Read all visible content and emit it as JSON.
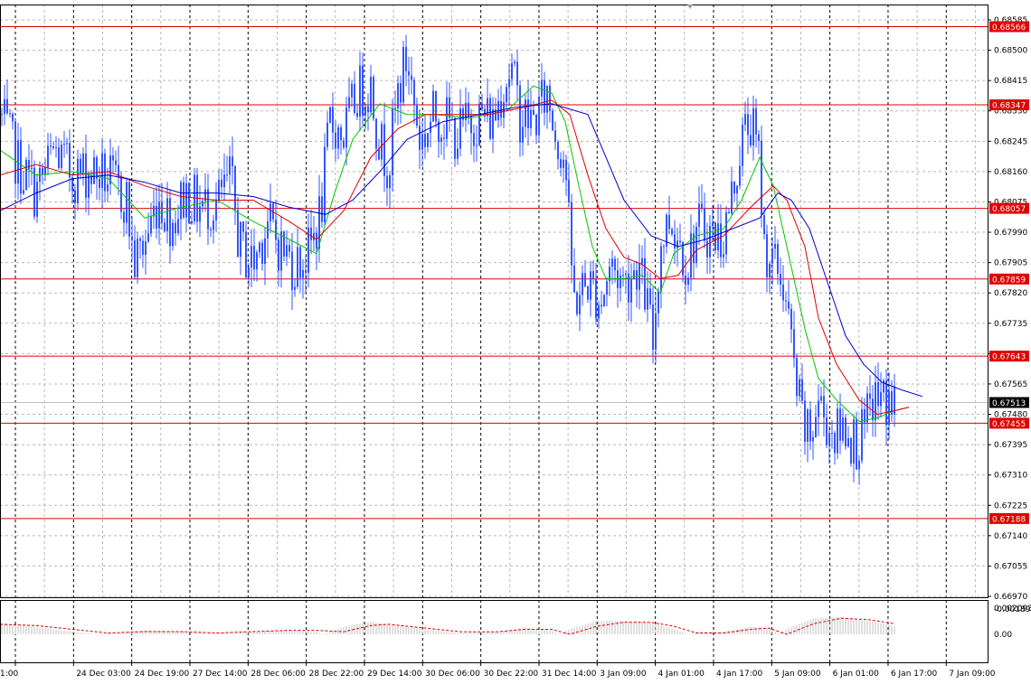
{
  "chart_data": [
    {
      "type": "candlestick",
      "title": "",
      "ylim": [
        0.6697,
        0.68585
      ],
      "y_ticks": [
        "0.68585",
        "0.68500",
        "0.68415",
        "0.68330",
        "0.68245",
        "0.68160",
        "0.68075",
        "0.67990",
        "0.67905",
        "0.67820",
        "0.67735",
        "0.67650",
        "0.67565",
        "0.67480",
        "0.67395",
        "0.67310",
        "0.67225",
        "0.67140",
        "0.67055",
        "0.66970"
      ],
      "x_ticks": [
        "1:00",
        "24 Dec 03:00",
        "24 Dec 19:00",
        "27 Dec 14:00",
        "28 Dec 06:00",
        "28 Dec 22:00",
        "29 Dec 14:00",
        "30 Dec 06:00",
        "30 Dec 22:00",
        "31 Dec 14:00",
        "3 Jan 09:00",
        "4 Jan 01:00",
        "4 Jan 17:00",
        "5 Jan 09:00",
        "6 Jan 01:00",
        "6 Jan 17:00",
        "7 Jan 09:00"
      ],
      "current_price": "0.67513",
      "horizontal_levels": [
        "0.68566",
        "0.68347",
        "0.68057",
        "0.67859",
        "0.67643",
        "0.67455",
        "0.67188"
      ],
      "price_path": [
        [
          0,
          0.6832
        ],
        [
          20,
          0.6818
        ],
        [
          40,
          0.681
        ],
        [
          60,
          0.6822
        ],
        [
          80,
          0.6815
        ],
        [
          100,
          0.6816
        ],
        [
          120,
          0.6814
        ],
        [
          140,
          0.6808
        ],
        [
          148,
          0.679
        ],
        [
          160,
          0.6796
        ],
        [
          175,
          0.6809
        ],
        [
          190,
          0.6802
        ],
        [
          205,
          0.681
        ],
        [
          220,
          0.6806
        ],
        [
          240,
          0.6807
        ],
        [
          255,
          0.6814
        ],
        [
          265,
          0.6795
        ],
        [
          280,
          0.679
        ],
        [
          295,
          0.6802
        ],
        [
          310,
          0.6795
        ],
        [
          325,
          0.679
        ],
        [
          340,
          0.6792
        ],
        [
          355,
          0.6805
        ],
        [
          365,
          0.683
        ],
        [
          380,
          0.6826
        ],
        [
          395,
          0.6838
        ],
        [
          410,
          0.684
        ],
        [
          420,
          0.6824
        ],
        [
          430,
          0.6818
        ],
        [
          440,
          0.6838
        ],
        [
          450,
          0.6848
        ],
        [
          465,
          0.6824
        ],
        [
          480,
          0.6832
        ],
        [
          495,
          0.683
        ],
        [
          505,
          0.6826
        ],
        [
          520,
          0.683
        ],
        [
          535,
          0.6832
        ],
        [
          545,
          0.683
        ],
        [
          555,
          0.684
        ],
        [
          565,
          0.6845
        ],
        [
          575,
          0.6832
        ],
        [
          590,
          0.683
        ],
        [
          605,
          0.6838
        ],
        [
          615,
          0.6826
        ],
        [
          625,
          0.682
        ],
        [
          630,
          0.6795
        ],
        [
          635,
          0.678
        ],
        [
          650,
          0.6785
        ],
        [
          665,
          0.678
        ],
        [
          675,
          0.679
        ],
        [
          690,
          0.6785
        ],
        [
          705,
          0.679
        ],
        [
          715,
          0.678
        ],
        [
          722,
          0.6768
        ],
        [
          730,
          0.6795
        ],
        [
          740,
          0.6803
        ],
        [
          750,
          0.6798
        ],
        [
          760,
          0.679
        ],
        [
          770,
          0.68
        ],
        [
          780,
          0.68
        ],
        [
          790,
          0.6798
        ],
        [
          800,
          0.6798
        ],
        [
          810,
          0.681
        ],
        [
          820,
          0.6825
        ],
        [
          830,
          0.683
        ],
        [
          840,
          0.6818
        ],
        [
          845,
          0.6795
        ],
        [
          855,
          0.679
        ],
        [
          865,
          0.6786
        ],
        [
          872,
          0.6774
        ],
        [
          880,
          0.6756
        ],
        [
          888,
          0.6745
        ],
        [
          895,
          0.674
        ],
        [
          905,
          0.6752
        ],
        [
          915,
          0.6745
        ],
        [
          925,
          0.6742
        ],
        [
          935,
          0.6745
        ],
        [
          945,
          0.674
        ],
        [
          955,
          0.6742
        ],
        [
          965,
          0.6752
        ],
        [
          975,
          0.6752
        ],
        [
          985,
          0.6751
        ],
        [
          989,
          0.67513
        ]
      ],
      "moving_averages": [
        {
          "color": "#00c800",
          "points": [
            [
              0,
              0.6822
            ],
            [
              40,
              0.6815
            ],
            [
              80,
              0.6816
            ],
            [
              120,
              0.6814
            ],
            [
              160,
              0.6803
            ],
            [
              200,
              0.6806
            ],
            [
              240,
              0.6808
            ],
            [
              280,
              0.6802
            ],
            [
              320,
              0.6797
            ],
            [
              350,
              0.6793
            ],
            [
              370,
              0.681
            ],
            [
              390,
              0.6825
            ],
            [
              420,
              0.6835
            ],
            [
              450,
              0.6832
            ],
            [
              480,
              0.6832
            ],
            [
              520,
              0.6831
            ],
            [
              560,
              0.6833
            ],
            [
              590,
              0.684
            ],
            [
              610,
              0.6838
            ],
            [
              625,
              0.683
            ],
            [
              640,
              0.6812
            ],
            [
              655,
              0.6795
            ],
            [
              670,
              0.6786
            ],
            [
              690,
              0.6786
            ],
            [
              710,
              0.6787
            ],
            [
              730,
              0.6782
            ],
            [
              745,
              0.6793
            ],
            [
              770,
              0.6798
            ],
            [
              800,
              0.68
            ],
            [
              820,
              0.6808
            ],
            [
              840,
              0.682
            ],
            [
              855,
              0.6812
            ],
            [
              870,
              0.6795
            ],
            [
              890,
              0.6772
            ],
            [
              905,
              0.6758
            ],
            [
              925,
              0.6752
            ],
            [
              950,
              0.6746
            ],
            [
              970,
              0.6747
            ],
            [
              989,
              0.6749
            ],
            [
              1005,
              0.675
            ]
          ]
        },
        {
          "color": "#dd0000",
          "points": [
            [
              0,
              0.6815
            ],
            [
              40,
              0.6818
            ],
            [
              80,
              0.6815
            ],
            [
              120,
              0.6816
            ],
            [
              160,
              0.6812
            ],
            [
              200,
              0.6809
            ],
            [
              240,
              0.6808
            ],
            [
              280,
              0.6808
            ],
            [
              320,
              0.6802
            ],
            [
              350,
              0.6797
            ],
            [
              380,
              0.6805
            ],
            [
              410,
              0.682
            ],
            [
              440,
              0.6828
            ],
            [
              470,
              0.6832
            ],
            [
              500,
              0.6832
            ],
            [
              540,
              0.6832
            ],
            [
              580,
              0.6834
            ],
            [
              610,
              0.6836
            ],
            [
              630,
              0.6832
            ],
            [
              650,
              0.6815
            ],
            [
              670,
              0.68
            ],
            [
              690,
              0.6792
            ],
            [
              710,
              0.679
            ],
            [
              730,
              0.6786
            ],
            [
              750,
              0.6787
            ],
            [
              770,
              0.6794
            ],
            [
              800,
              0.6798
            ],
            [
              830,
              0.6806
            ],
            [
              855,
              0.6812
            ],
            [
              870,
              0.6808
            ],
            [
              890,
              0.6795
            ],
            [
              905,
              0.6775
            ],
            [
              925,
              0.6762
            ],
            [
              950,
              0.6752
            ],
            [
              970,
              0.6748
            ],
            [
              989,
              0.6749
            ],
            [
              1005,
              0.675
            ]
          ]
        },
        {
          "color": "#0000cc",
          "points": [
            [
              0,
              0.6805
            ],
            [
              40,
              0.681
            ],
            [
              80,
              0.6814
            ],
            [
              120,
              0.6815
            ],
            [
              160,
              0.6813
            ],
            [
              200,
              0.681
            ],
            [
              240,
              0.681
            ],
            [
              280,
              0.6809
            ],
            [
              320,
              0.6806
            ],
            [
              360,
              0.6804
            ],
            [
              390,
              0.6808
            ],
            [
              420,
              0.6816
            ],
            [
              450,
              0.6825
            ],
            [
              490,
              0.683
            ],
            [
              530,
              0.6832
            ],
            [
              570,
              0.6834
            ],
            [
              610,
              0.6835
            ],
            [
              650,
              0.6832
            ],
            [
              670,
              0.682
            ],
            [
              690,
              0.6808
            ],
            [
              720,
              0.6798
            ],
            [
              750,
              0.6795
            ],
            [
              780,
              0.6797
            ],
            [
              810,
              0.68
            ],
            [
              840,
              0.6803
            ],
            [
              860,
              0.681
            ],
            [
              875,
              0.6808
            ],
            [
              895,
              0.68
            ],
            [
              915,
              0.6785
            ],
            [
              935,
              0.677
            ],
            [
              955,
              0.6762
            ],
            [
              975,
              0.6757
            ],
            [
              995,
              0.6755
            ],
            [
              1020,
              0.6753
            ]
          ]
        }
      ]
    },
    {
      "type": "histogram",
      "title": "",
      "ylim": [
        -0.001893,
        0.002093
      ],
      "y_ticks": [
        "0.002093",
        "0.00",
        "-0.001893"
      ],
      "signal_color": "#dd0000",
      "histogram_path": [
        [
          0,
          0.0009
        ],
        [
          40,
          0.0006
        ],
        [
          80,
          0.0002
        ],
        [
          120,
          -0.0001
        ],
        [
          160,
          -0.0003
        ],
        [
          200,
          -0.0002
        ],
        [
          240,
          -0.0001
        ],
        [
          280,
          -0.0002
        ],
        [
          320,
          -0.0003
        ],
        [
          350,
          -0.0002
        ],
        [
          380,
          0.0006
        ],
        [
          410,
          0.001
        ],
        [
          430,
          0.0008
        ],
        [
          470,
          0.0004
        ],
        [
          510,
          0.0001
        ],
        [
          550,
          0.0002
        ],
        [
          580,
          0.0005
        ],
        [
          610,
          0.0003
        ],
        [
          630,
          -0.0004
        ],
        [
          660,
          -0.001
        ],
        [
          690,
          -0.001
        ],
        [
          720,
          -0.0009
        ],
        [
          745,
          -0.0004
        ],
        [
          770,
          0.0002
        ],
        [
          800,
          0.0002
        ],
        [
          830,
          0.0006
        ],
        [
          850,
          0.0005
        ],
        [
          870,
          -0.0004
        ],
        [
          900,
          -0.0012
        ],
        [
          930,
          -0.0013
        ],
        [
          960,
          -0.001
        ],
        [
          989,
          -0.0006
        ]
      ],
      "signal_path": [
        [
          0,
          0.0008
        ],
        [
          40,
          0.0007
        ],
        [
          80,
          0.0004
        ],
        [
          120,
          0.0001
        ],
        [
          160,
          -0.0002
        ],
        [
          200,
          -0.0002
        ],
        [
          240,
          -0.0001
        ],
        [
          280,
          -0.0002
        ],
        [
          320,
          -0.0003
        ],
        [
          350,
          -0.0003
        ],
        [
          380,
          0.0002
        ],
        [
          410,
          0.0007
        ],
        [
          430,
          0.0008
        ],
        [
          470,
          0.0005
        ],
        [
          510,
          0.0002
        ],
        [
          550,
          0.0002
        ],
        [
          580,
          0.0004
        ],
        [
          610,
          0.0004
        ],
        [
          630,
          0.0
        ],
        [
          660,
          -0.0006
        ],
        [
          690,
          -0.0009
        ],
        [
          720,
          -0.0009
        ],
        [
          745,
          -0.0006
        ],
        [
          770,
          -0.0001
        ],
        [
          800,
          0.0001
        ],
        [
          830,
          0.0004
        ],
        [
          850,
          0.0005
        ],
        [
          870,
          0.0
        ],
        [
          900,
          -0.0008
        ],
        [
          930,
          -0.0012
        ],
        [
          960,
          -0.0011
        ],
        [
          989,
          -0.0008
        ]
      ]
    }
  ]
}
